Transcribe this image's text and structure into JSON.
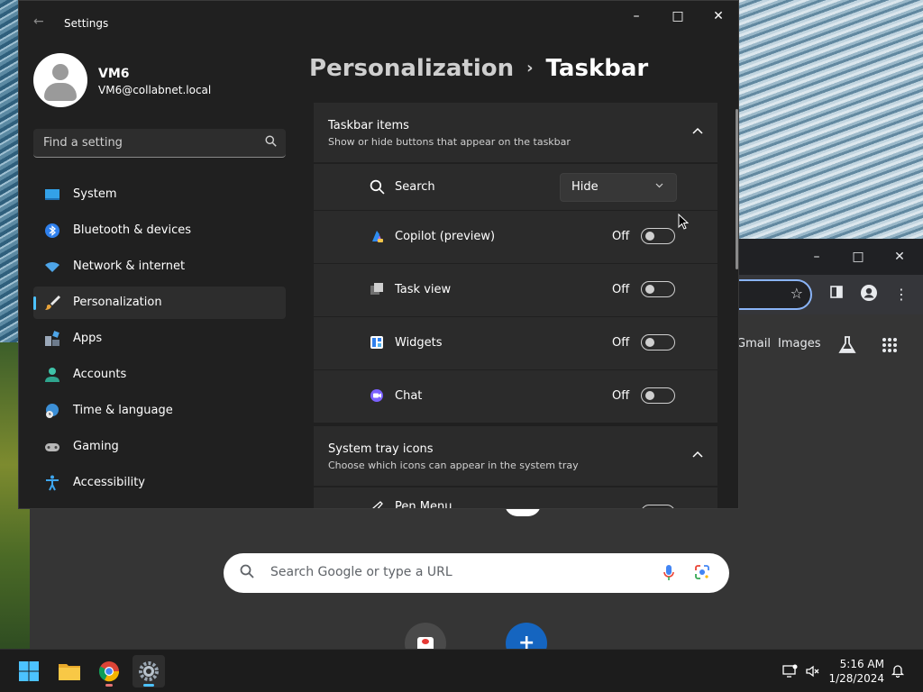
{
  "settings": {
    "app_title": "Settings",
    "user": {
      "name": "VM6",
      "email": "VM6@collabnet.local"
    },
    "search_placeholder": "Find a setting",
    "nav": [
      {
        "label": "System"
      },
      {
        "label": "Bluetooth & devices"
      },
      {
        "label": "Network & internet"
      },
      {
        "label": "Personalization",
        "active": true
      },
      {
        "label": "Apps"
      },
      {
        "label": "Accounts"
      },
      {
        "label": "Time & language"
      },
      {
        "label": "Gaming"
      },
      {
        "label": "Accessibility"
      }
    ],
    "breadcrumb": {
      "parent": "Personalization",
      "separator": "›",
      "current": "Taskbar"
    },
    "taskbar_items": {
      "title": "Taskbar items",
      "subtitle": "Show or hide buttons that appear on the taskbar",
      "search": {
        "label": "Search",
        "value": "Hide"
      },
      "rows": [
        {
          "label": "Copilot (preview)",
          "state": "Off"
        },
        {
          "label": "Task view",
          "state": "Off"
        },
        {
          "label": "Widgets",
          "state": "Off"
        },
        {
          "label": "Chat",
          "state": "Off"
        }
      ]
    },
    "system_tray": {
      "title": "System tray icons",
      "subtitle": "Choose which icons can appear in the system tray",
      "first_row": "Pen Menu"
    }
  },
  "chrome": {
    "links": {
      "gmail": "Gmail",
      "images": "Images"
    },
    "search_placeholder": "Search Google or type a URL"
  },
  "taskbar": {
    "time": "5:16 AM",
    "date": "1/28/2024"
  },
  "colors": {
    "accent": "#4cc2ff",
    "window_bg": "#202020",
    "card_bg": "#2b2b2b"
  }
}
